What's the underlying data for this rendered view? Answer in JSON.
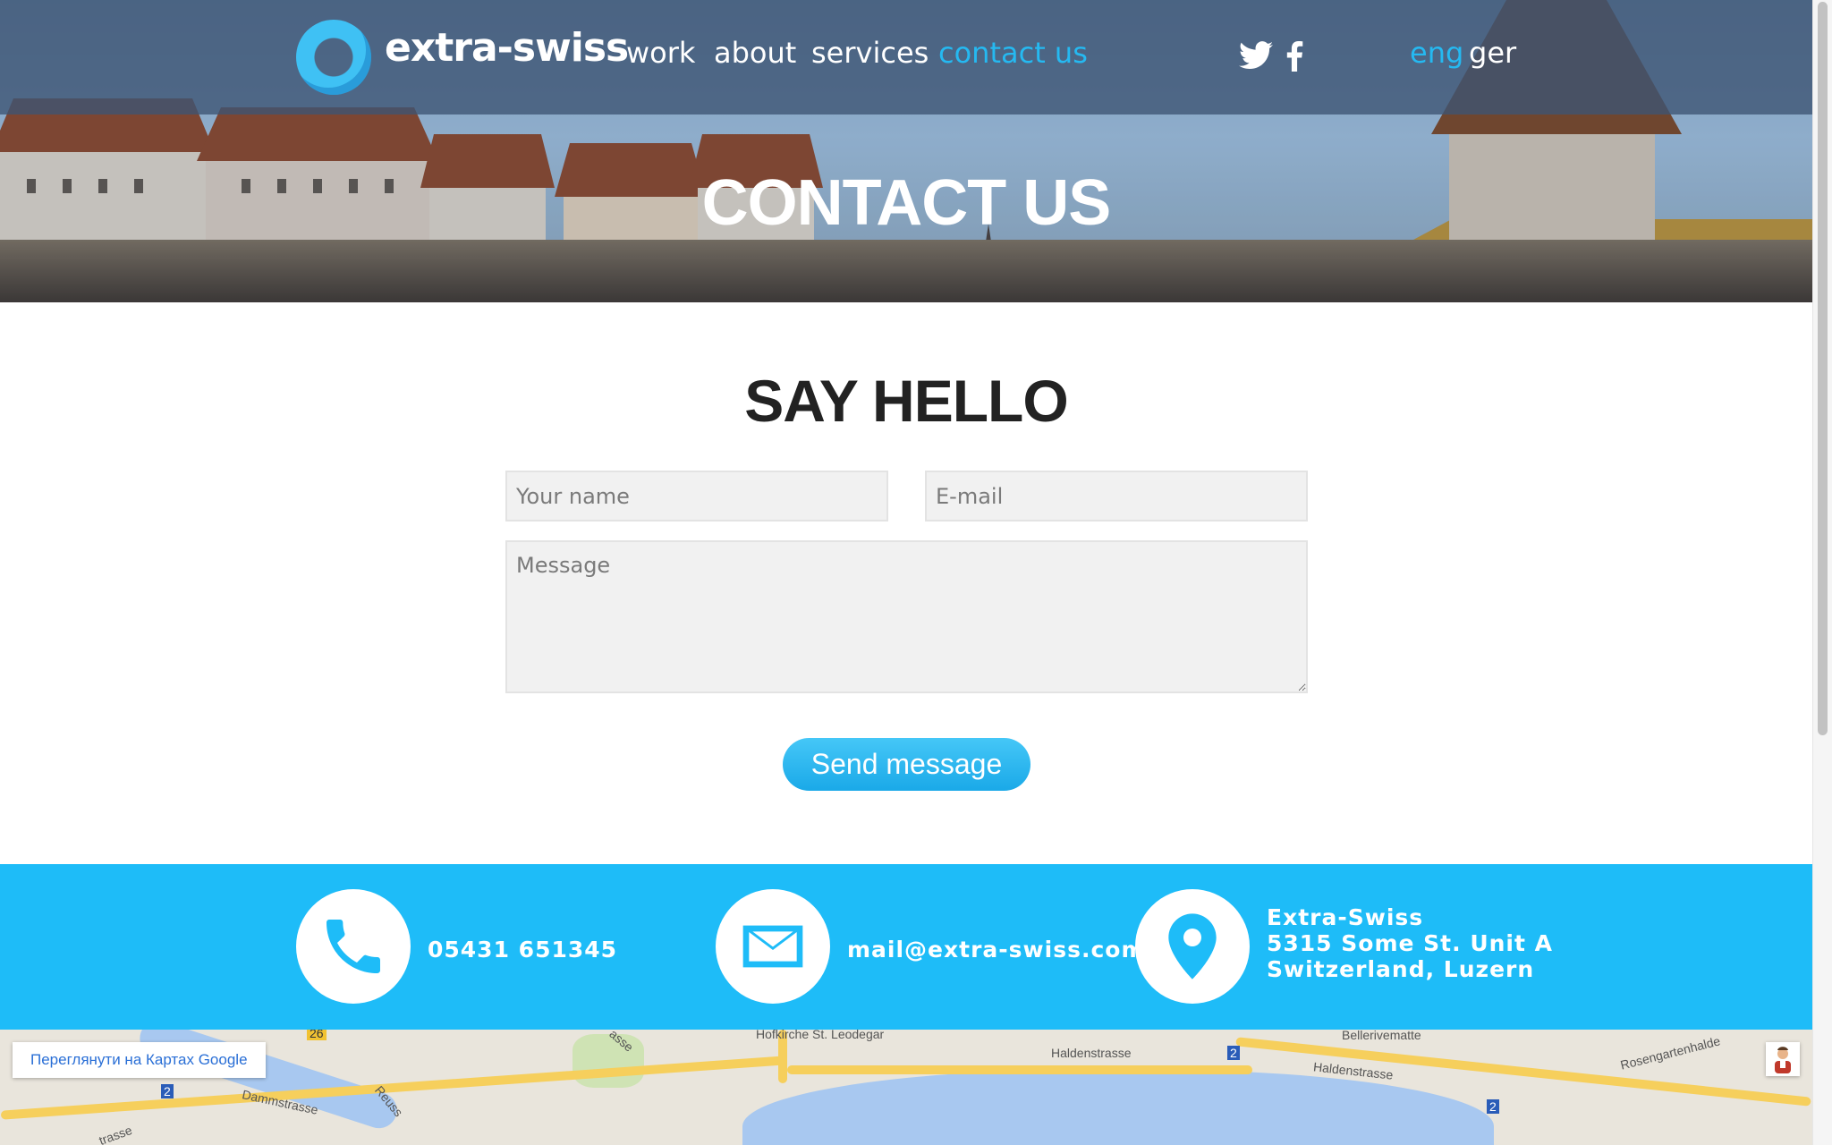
{
  "header": {
    "brand": "extra-swiss",
    "nav": [
      {
        "label": "work",
        "active": false
      },
      {
        "label": "about",
        "active": false
      },
      {
        "label": "services",
        "active": false
      },
      {
        "label": "contact us",
        "active": true
      }
    ],
    "social": [
      {
        "icon": "twitter-icon"
      },
      {
        "icon": "facebook-icon"
      }
    ],
    "languages": [
      {
        "label": "eng",
        "active": true
      },
      {
        "label": "ger",
        "active": false
      }
    ]
  },
  "hero": {
    "title": "CONTACT US"
  },
  "form": {
    "title": "SAY HELLO",
    "name_placeholder": "Your name",
    "email_placeholder": "E-mail",
    "message_placeholder": "Message",
    "submit_label": "Send message"
  },
  "contact": {
    "phone": "05431 651345",
    "email": "mail@extra-swiss.com",
    "address": [
      "Extra-Swiss",
      "5315 Some St. Unit A",
      "Switzerland, Luzern"
    ]
  },
  "map": {
    "view_button": "Переглянути на Картах Google",
    "labels": [
      "Hofkirche St. Leodegar",
      "Haldenstrasse",
      "Haldenstrasse",
      "Bellerivematte",
      "Rosengartenhalde",
      "Dammstrasse",
      "Reuss",
      "trasse",
      "asse",
      "2",
      "2",
      "2",
      "26"
    ]
  },
  "colors": {
    "accent": "#1ebcf8",
    "nav_active": "#25b9f1",
    "topbar": "#3e5573"
  }
}
